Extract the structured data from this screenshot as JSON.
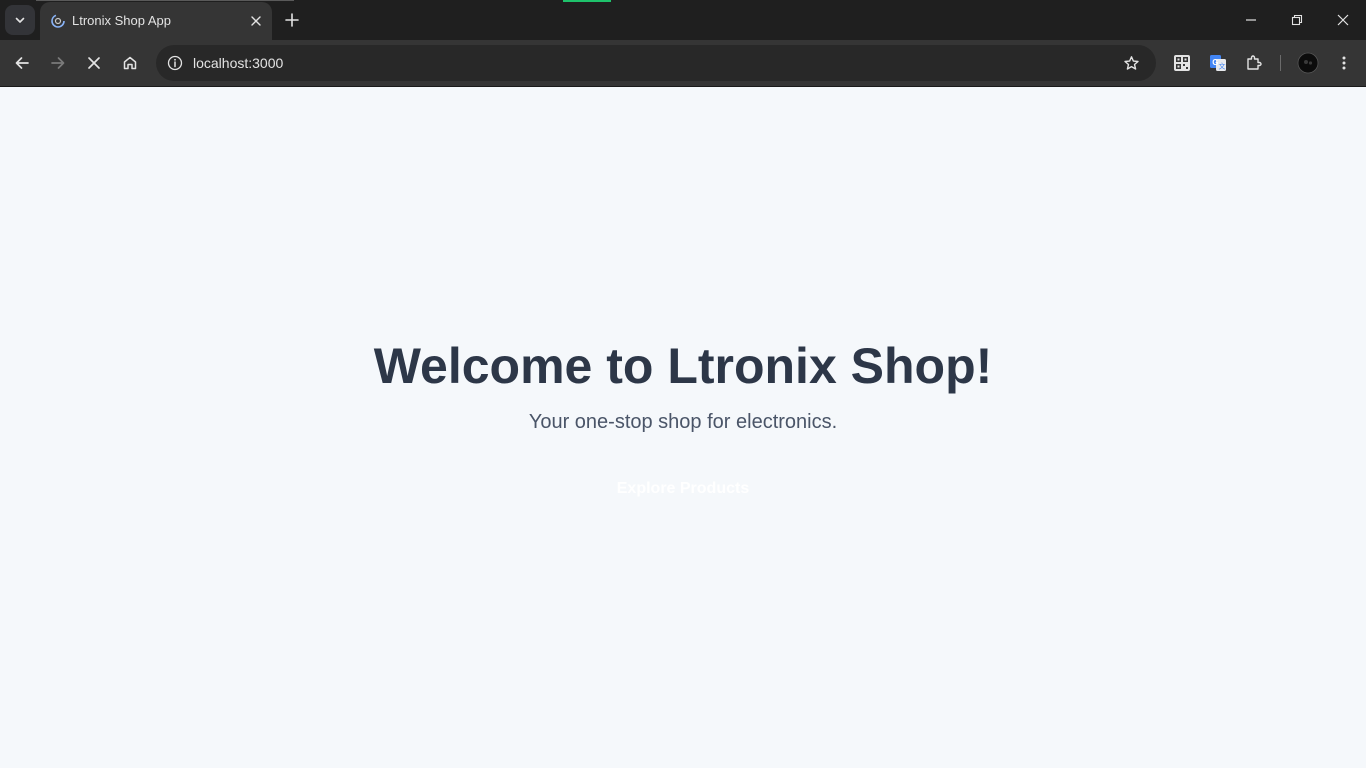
{
  "browser": {
    "tab": {
      "title": "Ltronix Shop App"
    },
    "address_bar": {
      "url": "localhost:3000"
    },
    "icons": {
      "tab_search": "chevron-down-icon",
      "favicon": "loading-favicon-icon",
      "tab_close": "close-icon",
      "new_tab": "plus-icon",
      "back": "arrow-left-icon",
      "forward": "arrow-right-icon",
      "stop": "close-icon",
      "home": "home-icon",
      "site_info": "info-icon",
      "bookmark": "star-icon",
      "qr_extension": "qr-code-icon",
      "translate_extension": "translate-icon",
      "extensions": "puzzle-icon",
      "profile": "avatar",
      "menu": "kebab-menu-icon"
    },
    "colors": {
      "tabstrip": "#1f1f1f",
      "toolbar": "#353535",
      "omnibox": "#282828",
      "loading_indicator": "#1ec26b"
    }
  },
  "page": {
    "title": "Welcome to Ltronix Shop!",
    "subtitle": "Your one-stop shop for electronics.",
    "cta_label": "Explore Products",
    "colors": {
      "background": "#f5f8fb",
      "title": "#2d3748",
      "subtitle": "#4a5568",
      "cta_text": "#ffffff"
    }
  }
}
